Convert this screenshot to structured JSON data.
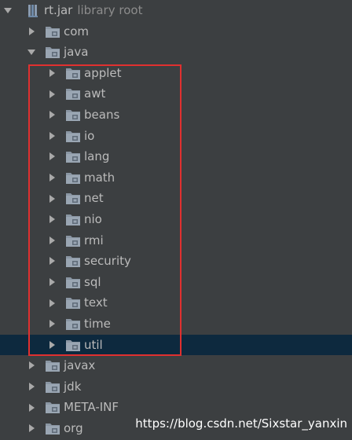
{
  "root": {
    "label": "rt.jar",
    "suffix": "library root"
  },
  "packages": [
    {
      "label": "com"
    },
    {
      "label": "java"
    },
    {
      "label": "applet"
    },
    {
      "label": "awt"
    },
    {
      "label": "beans"
    },
    {
      "label": "io"
    },
    {
      "label": "lang"
    },
    {
      "label": "math"
    },
    {
      "label": "net"
    },
    {
      "label": "nio"
    },
    {
      "label": "rmi"
    },
    {
      "label": "security"
    },
    {
      "label": "sql"
    },
    {
      "label": "text"
    },
    {
      "label": "time"
    },
    {
      "label": "util"
    },
    {
      "label": "javax"
    },
    {
      "label": "jdk"
    },
    {
      "label": "META-INF"
    },
    {
      "label": "org"
    }
  ],
  "watermark": "https://blog.csdn.net/Sixstar_yanxin",
  "colors": {
    "background": "#3c3f41",
    "selected_row": "#0d293e",
    "highlight_box": "#e0302f",
    "text": "#bbbbbb"
  }
}
